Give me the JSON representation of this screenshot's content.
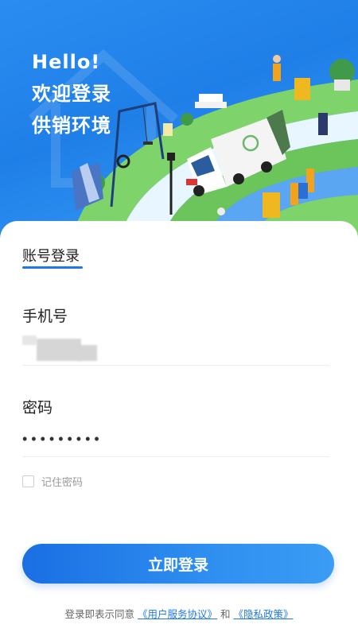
{
  "hero": {
    "line1": "Hello!",
    "line2": "欢迎登录",
    "line3": "供销环境"
  },
  "login": {
    "tab_label": "账号登录",
    "phone_label": "手机号",
    "phone_value_masked": true,
    "password_label": "密码",
    "password_value": "•••••••••",
    "remember_label": "记住密码",
    "remember_checked": false,
    "submit_label": "立即登录"
  },
  "agreement": {
    "prefix": "登录即表示同意",
    "terms_link": "《用户服务协议》",
    "and": "和",
    "privacy_link": "《隐私政策》"
  },
  "colors": {
    "primary": "#1e78e6",
    "hero_bg": "#2a8cf0"
  },
  "icons": [
    "checkbox-icon"
  ]
}
